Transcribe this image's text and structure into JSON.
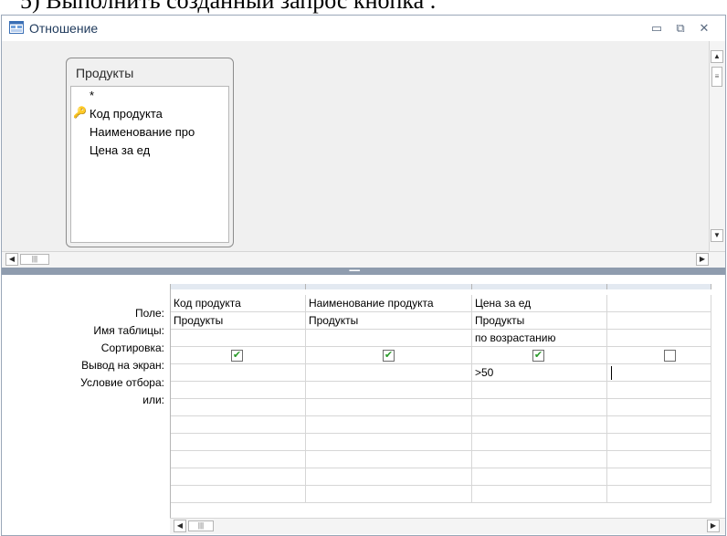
{
  "document": {
    "cut_text": "5) Выполнить созданный запрос кнопка ."
  },
  "window": {
    "title": "Отношение"
  },
  "table": {
    "name": "Продукты",
    "fields": [
      "*",
      "Код продукта",
      "Наименование про",
      "Цена за ед"
    ]
  },
  "grid": {
    "row_labels": [
      "Поле:",
      "Имя таблицы:",
      "Сортировка:",
      "Вывод на экран:",
      "Условие отбора:",
      "или:"
    ],
    "columns": [
      {
        "field": "Код продукта",
        "table": "Продукты",
        "sort": "",
        "show": true,
        "criteria": ""
      },
      {
        "field": "Наименование продукта",
        "table": "Продукты",
        "sort": "",
        "show": true,
        "criteria": ""
      },
      {
        "field": "Цена за ед",
        "table": "Продукты",
        "sort": "по возрастанию",
        "show": true,
        "criteria": ">50"
      },
      {
        "field": "",
        "table": "",
        "sort": "",
        "show": false,
        "criteria": ""
      }
    ]
  },
  "icons": {
    "title": "query-window-icon",
    "key": "primary-key-icon",
    "check": "checkmark-icon"
  },
  "colors": {
    "splitter": "#8f9cae",
    "check": "#2a9a2a",
    "title": "#1e395b"
  }
}
